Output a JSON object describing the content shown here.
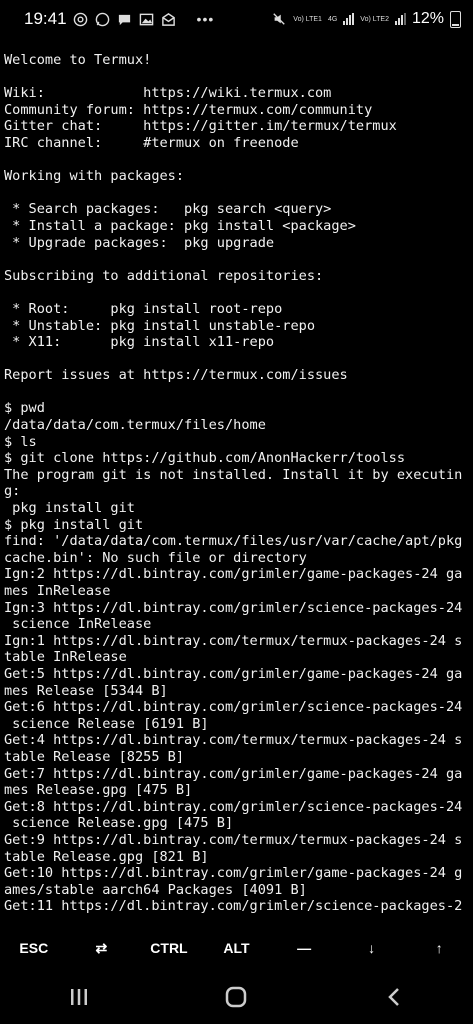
{
  "status_bar": {
    "time": "19:41",
    "net1": "Vo) LTE1",
    "net2": "Vo) LTE2",
    "network_type": "4G",
    "battery": "12%",
    "overflow": "•••"
  },
  "terminal_lines": [
    "Welcome to Termux!",
    "",
    "Wiki:            https://wiki.termux.com",
    "Community forum: https://termux.com/community",
    "Gitter chat:     https://gitter.im/termux/termux",
    "IRC channel:     #termux on freenode",
    "",
    "Working with packages:",
    "",
    " * Search packages:   pkg search <query>",
    " * Install a package: pkg install <package>",
    " * Upgrade packages:  pkg upgrade",
    "",
    "Subscribing to additional repositories:",
    "",
    " * Root:     pkg install root-repo",
    " * Unstable: pkg install unstable-repo",
    " * X11:      pkg install x11-repo",
    "",
    "Report issues at https://termux.com/issues",
    "",
    "$ pwd",
    "/data/data/com.termux/files/home",
    "$ ls",
    "$ git clone https://github.com/AnonHackerr/toolss",
    "The program git is not installed. Install it by executin",
    "g:",
    " pkg install git",
    "$ pkg install git",
    "find: '/data/data/com.termux/files/usr/var/cache/apt/pkg",
    "cache.bin': No such file or directory",
    "Ign:2 https://dl.bintray.com/grimler/game-packages-24 ga",
    "mes InRelease",
    "Ign:3 https://dl.bintray.com/grimler/science-packages-24",
    " science InRelease",
    "Ign:1 https://dl.bintray.com/termux/termux-packages-24 s",
    "table InRelease",
    "Get:5 https://dl.bintray.com/grimler/game-packages-24 ga",
    "mes Release [5344 B]",
    "Get:6 https://dl.bintray.com/grimler/science-packages-24",
    " science Release [6191 B]",
    "Get:4 https://dl.bintray.com/termux/termux-packages-24 s",
    "table Release [8255 B]",
    "Get:7 https://dl.bintray.com/grimler/game-packages-24 ga",
    "mes Release.gpg [475 B]",
    "Get:8 https://dl.bintray.com/grimler/science-packages-24",
    " science Release.gpg [475 B]",
    "Get:9 https://dl.bintray.com/termux/termux-packages-24 s",
    "table Release.gpg [821 B]",
    "Get:10 https://dl.bintray.com/grimler/game-packages-24 g",
    "ames/stable aarch64 Packages [4091 B]",
    "Get:11 https://dl.bintray.com/grimler/science-packages-2"
  ],
  "extra_keys": {
    "esc": "ESC",
    "tab": "⇄",
    "ctrl": "CTRL",
    "alt": "ALT",
    "dash": "—",
    "down": "↓",
    "up": "↑"
  },
  "icons": {
    "recents": "recents-icon",
    "home": "home-icon",
    "back": "back-icon"
  }
}
